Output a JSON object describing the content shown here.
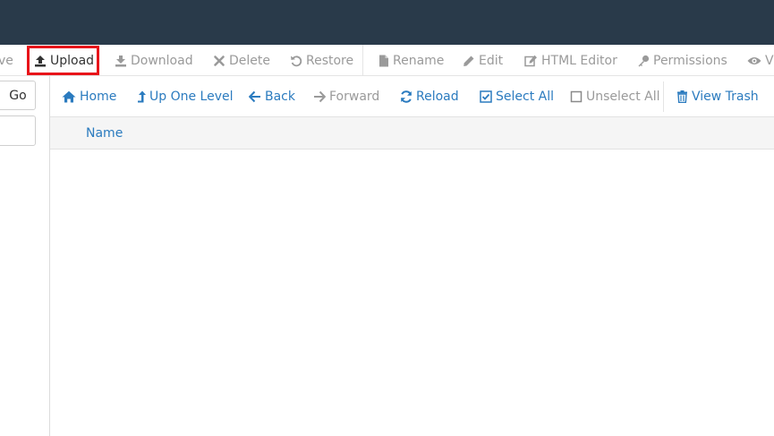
{
  "toolbar": {
    "items": [
      {
        "label": "ve",
        "icon": "move-icon"
      },
      {
        "label": "Upload",
        "icon": "upload-icon"
      },
      {
        "label": "Download",
        "icon": "download-icon"
      },
      {
        "label": "Delete",
        "icon": "delete-icon"
      },
      {
        "label": "Restore",
        "icon": "restore-icon"
      },
      {
        "label": "Rename",
        "icon": "file-icon"
      },
      {
        "label": "Edit",
        "icon": "pencil-icon"
      },
      {
        "label": "HTML Editor",
        "icon": "html-editor-icon"
      },
      {
        "label": "Permissions",
        "icon": "key-icon"
      },
      {
        "label": "Vi",
        "icon": "eye-icon"
      }
    ],
    "highlighted": "Upload"
  },
  "left_panel": {
    "go_label": "Go"
  },
  "navbar": {
    "items": [
      {
        "label": "Home",
        "icon": "home-icon"
      },
      {
        "label": "Up One Level",
        "icon": "level-up-icon"
      },
      {
        "label": "Back",
        "icon": "arrow-left-icon"
      },
      {
        "label": "Forward",
        "icon": "arrow-right-icon"
      },
      {
        "label": "Reload",
        "icon": "refresh-icon"
      },
      {
        "label": "Select All",
        "icon": "checkbox-checked-icon"
      },
      {
        "label": "Unselect All",
        "icon": "checkbox-empty-icon"
      },
      {
        "label": "View Trash",
        "icon": "trash-icon"
      }
    ]
  },
  "table": {
    "columns": [
      "Name"
    ]
  },
  "colors": {
    "topbar": "#293a4a",
    "link": "#2b7bbf",
    "disabled": "#9a9a9a",
    "highlight": "#e8141a"
  }
}
